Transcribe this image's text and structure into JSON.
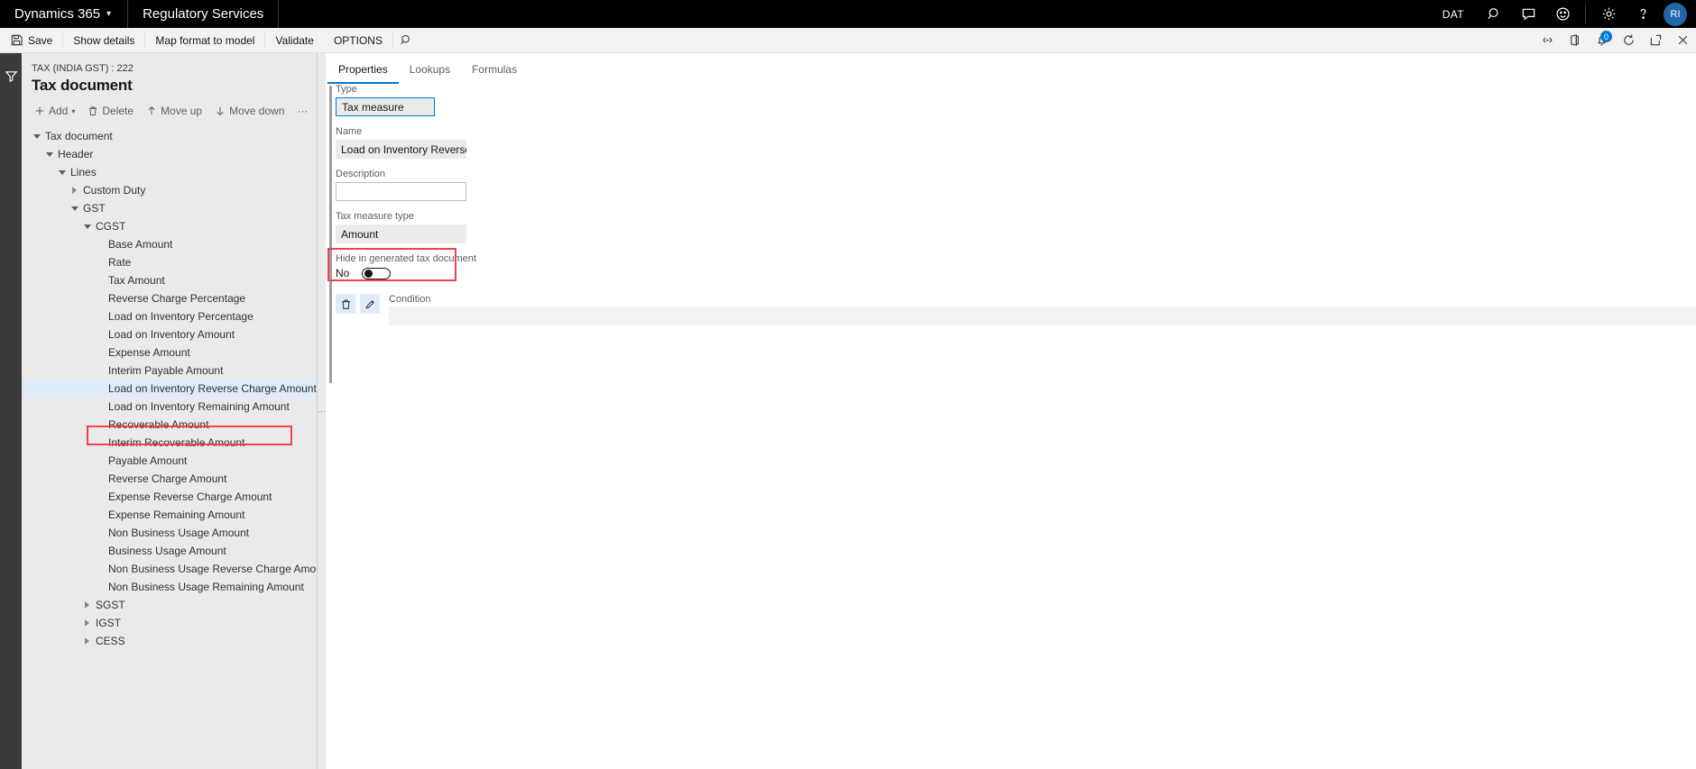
{
  "topnav": {
    "brand": "Dynamics 365",
    "brand_chevron": "chevron-down-icon",
    "module": "Regulatory Services",
    "company": "DAT",
    "icons": [
      "search-icon",
      "feedback-icon",
      "smiley-icon",
      "gear-icon",
      "help-icon"
    ],
    "avatar_initials": "RI",
    "accent_color": "#0078d4",
    "bar_color": "#000000"
  },
  "actionpane": {
    "save_label": "Save",
    "save_icon": "save-icon",
    "buttons": [
      "Show details",
      "Map format to model",
      "Validate",
      "OPTIONS"
    ],
    "search_icon": "search-icon",
    "right_icons": [
      "attach-icon",
      "office-app-icon",
      "notifications-icon",
      "refresh-icon",
      "popout-icon",
      "close-icon"
    ],
    "notification_count": "0"
  },
  "rail": {
    "filter_icon": "filter-icon"
  },
  "treepanel": {
    "breadcrumb": "TAX (INDIA GST) : 222",
    "title": "Tax document",
    "toolbar": [
      {
        "label": "Add",
        "icon": "plus-icon",
        "chevron": "⌄"
      },
      {
        "label": "Delete",
        "icon": "trash-icon"
      },
      {
        "label": "Move up",
        "icon": "arrow-up-icon"
      },
      {
        "label": "Move down",
        "icon": "arrow-down-icon"
      },
      {
        "label": "···",
        "icon": "overflow-icon"
      }
    ],
    "nodes": [
      {
        "label": "Tax document",
        "depth": 0,
        "state": "open"
      },
      {
        "label": "Header",
        "depth": 1,
        "state": "open"
      },
      {
        "label": "Lines",
        "depth": 2,
        "state": "open"
      },
      {
        "label": "Custom Duty",
        "depth": 3,
        "state": "closed"
      },
      {
        "label": "GST",
        "depth": 3,
        "state": "open"
      },
      {
        "label": "CGST",
        "depth": 4,
        "state": "open"
      },
      {
        "label": "Base Amount",
        "depth": 5,
        "state": "leaf"
      },
      {
        "label": "Rate",
        "depth": 5,
        "state": "leaf"
      },
      {
        "label": "Tax Amount",
        "depth": 5,
        "state": "leaf"
      },
      {
        "label": "Reverse Charge Percentage",
        "depth": 5,
        "state": "leaf"
      },
      {
        "label": "Load on Inventory Percentage",
        "depth": 5,
        "state": "leaf"
      },
      {
        "label": "Load on Inventory Amount",
        "depth": 5,
        "state": "leaf"
      },
      {
        "label": "Expense Amount",
        "depth": 5,
        "state": "leaf"
      },
      {
        "label": "Interim Payable Amount",
        "depth": 5,
        "state": "leaf"
      },
      {
        "label": "Load on Inventory Reverse Charge Amount",
        "depth": 5,
        "state": "leaf",
        "selected": true
      },
      {
        "label": "Load on Inventory Remaining Amount",
        "depth": 5,
        "state": "leaf"
      },
      {
        "label": "Recoverable Amount",
        "depth": 5,
        "state": "leaf"
      },
      {
        "label": "Interim Recoverable Amount",
        "depth": 5,
        "state": "leaf"
      },
      {
        "label": "Payable Amount",
        "depth": 5,
        "state": "leaf"
      },
      {
        "label": "Reverse Charge Amount",
        "depth": 5,
        "state": "leaf"
      },
      {
        "label": "Expense Reverse Charge Amount",
        "depth": 5,
        "state": "leaf"
      },
      {
        "label": "Expense Remaining Amount",
        "depth": 5,
        "state": "leaf"
      },
      {
        "label": "Non Business Usage Amount",
        "depth": 5,
        "state": "leaf"
      },
      {
        "label": "Business Usage Amount",
        "depth": 5,
        "state": "leaf"
      },
      {
        "label": "Non Business Usage Reverse Charge Amount",
        "depth": 5,
        "state": "leaf"
      },
      {
        "label": "Non Business Usage Remaining Amount",
        "depth": 5,
        "state": "leaf"
      },
      {
        "label": "SGST",
        "depth": 4,
        "state": "closed"
      },
      {
        "label": "IGST",
        "depth": 4,
        "state": "closed"
      },
      {
        "label": "CESS",
        "depth": 4,
        "state": "closed"
      }
    ]
  },
  "splitter": {
    "dots": "⋮"
  },
  "content": {
    "tabs": [
      {
        "label": "Properties",
        "active": true
      },
      {
        "label": "Lookups",
        "active": false
      },
      {
        "label": "Formulas",
        "active": false
      }
    ],
    "fields": {
      "type": {
        "label": "Type",
        "value": "Tax measure"
      },
      "name": {
        "label": "Name",
        "value": "Load on Inventory Reverse Char..."
      },
      "description": {
        "label": "Description",
        "value": ""
      },
      "measure_type": {
        "label": "Tax measure type",
        "value": "Amount"
      },
      "hide": {
        "label": "Hide in generated tax document",
        "value": "No",
        "toggle_on": false
      }
    },
    "condition": {
      "label": "Condition",
      "value": "",
      "delete_icon": "trash-icon",
      "edit_icon": "pencil-icon"
    }
  },
  "annotations": {
    "color": "#f5404a",
    "boxes": [
      "tree-selected-node",
      "hide-in-generated-tax-document-field"
    ]
  }
}
